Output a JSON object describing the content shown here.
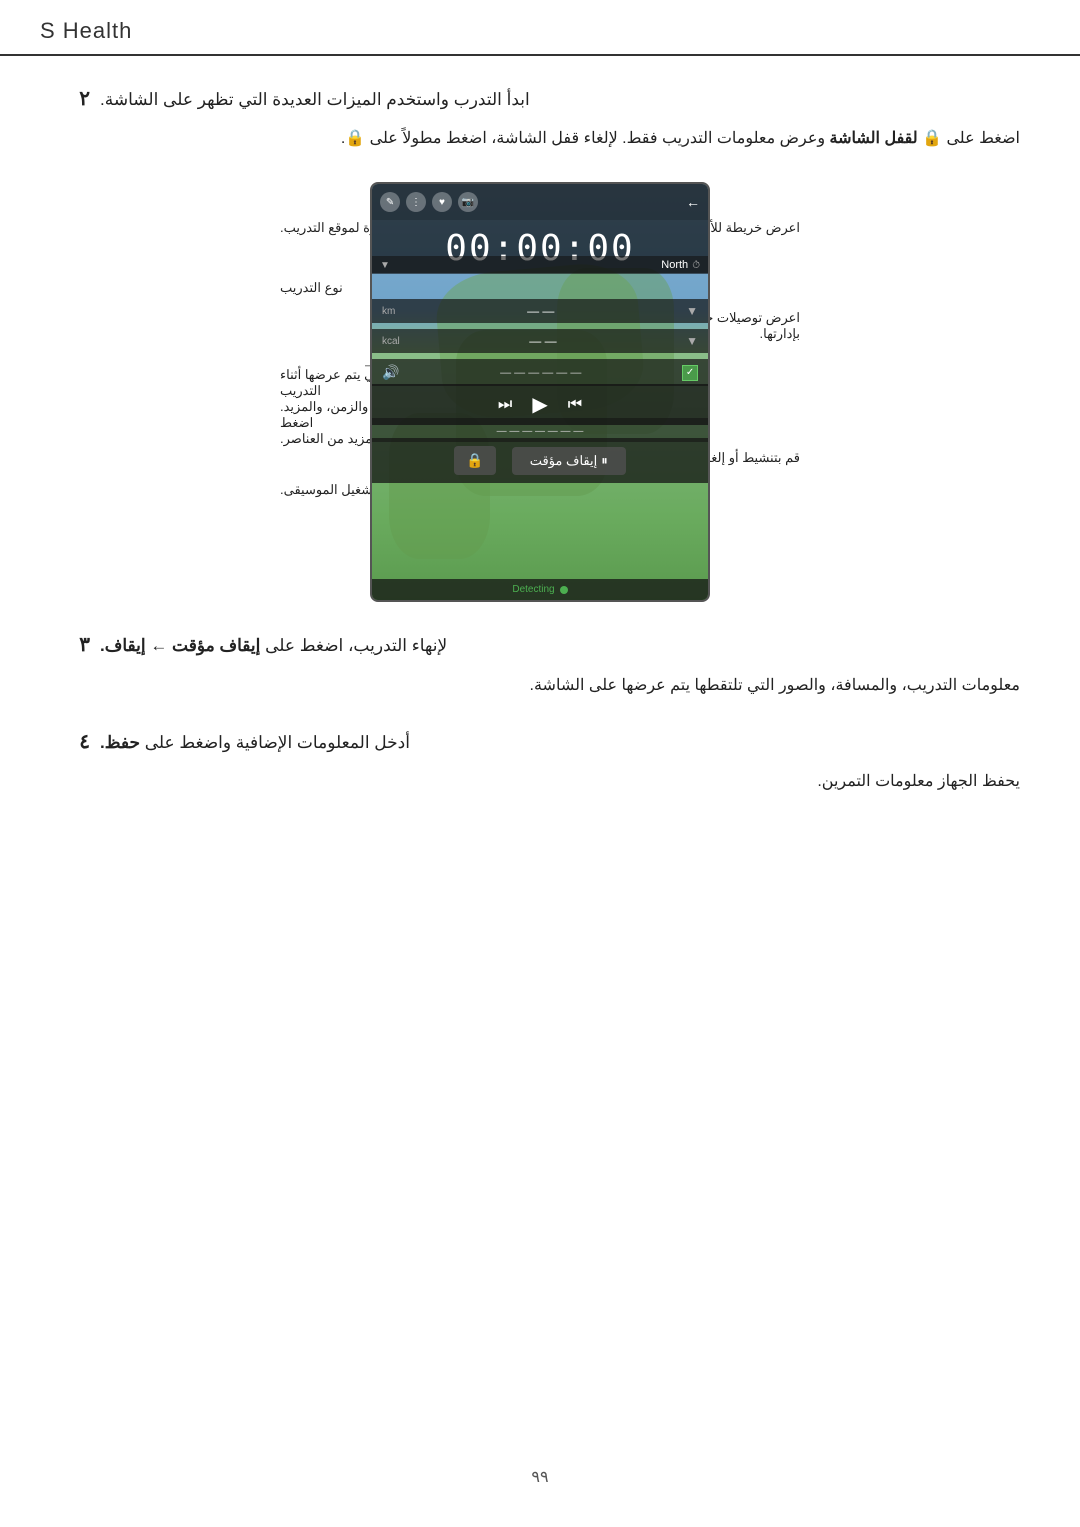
{
  "header": {
    "title": "S Health"
  },
  "steps": [
    {
      "number": "٢",
      "main_text": "ابدأ التدرب واستخدم الميزات العديدة التي تظهر على الشاشة.",
      "sub_text": "اضغط على  لقفل الشاشة وعرض معلومات التدريب فقط. لإلغاء قفل الشاشة، اضغط مطولاً على ."
    },
    {
      "number": "٣",
      "main_text": "لإنهاء التدريب، اضغط على إيقاف مؤقت ← إيقاف.",
      "sub_text": "معلومات التدريب، والمسافة، والصور التي تلتقطها يتم عرضها على الشاشة."
    },
    {
      "number": "٤",
      "main_text": "أدخل المعلومات الإضافية واضغط على حفظ.",
      "sub_text": "يحفظ الجهاز معلومات التمرين."
    }
  ],
  "annotations": {
    "top_right": "اعرض خريطة للأماكن التي تتدرب فيها.",
    "top_left": "التقط صورة لموقع التدريب.",
    "middle_right": "اعرض توصيلات جهاز الملحقات وقم بإدارتها.",
    "middle_left": "نوع التدريب",
    "info_right": "المعلومات التي يتم عرضها أثناء التدريب مثل السرعة، والزمن، والمزيد. اضغط لعرض مزيد من العناصر.",
    "audio_right": "قم بتنشيط أو إلغاء تنشيط الدليل الصوتي.",
    "music_left": "تحكم في تشغيل الموسيقى."
  },
  "device": {
    "timer": "00:00:00",
    "gps_status": "Detecting",
    "pause_label": "إيقاف مؤقت",
    "lock_icon": "🔒"
  },
  "page_number": "٩٩"
}
